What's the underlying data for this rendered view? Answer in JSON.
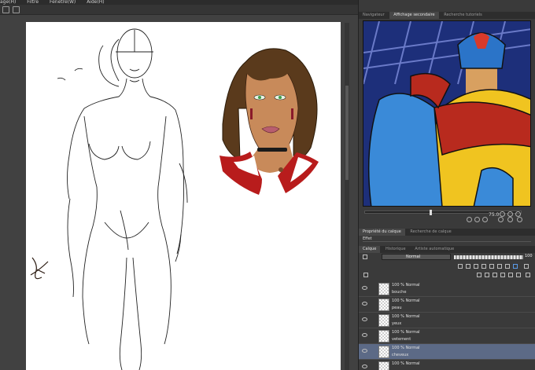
{
  "menu": {
    "items": [
      "age(H)",
      "Filtre",
      "Fenêtre(W)",
      "Aide(H)"
    ]
  },
  "navigator_panel": {
    "tabs": [
      "Navigateur",
      "Affichage secondaire",
      "Recherche tutoriels"
    ],
    "active_tab": 1,
    "zoom_label": "75.0",
    "zoom_level": 0.41
  },
  "properties_panel": {
    "tabs": [
      "Propriété du calque",
      "Recherche de calque"
    ],
    "effect_label": "Effet"
  },
  "layer_panel": {
    "tabs": [
      "Calque",
      "Historique",
      "Artiste automatique"
    ],
    "blend_mode": "Normal",
    "opacity": "100",
    "layers": [
      {
        "mode": "100 % Normal",
        "name": "bouche",
        "selected": false
      },
      {
        "mode": "100 % Normal",
        "name": "peau",
        "selected": false
      },
      {
        "mode": "100 % Normal",
        "name": "yeux",
        "selected": false
      },
      {
        "mode": "100 % Normal",
        "name": "vetement",
        "selected": false
      },
      {
        "mode": "100 % Normal",
        "name": "cheveux",
        "selected": true
      },
      {
        "mode": "100 % Normal",
        "name": "",
        "selected": false
      }
    ]
  },
  "colors": {
    "accent_selection": "#5c6a86",
    "panel_bg": "#3a3a3a",
    "canvas_bg": "#ffffff"
  }
}
